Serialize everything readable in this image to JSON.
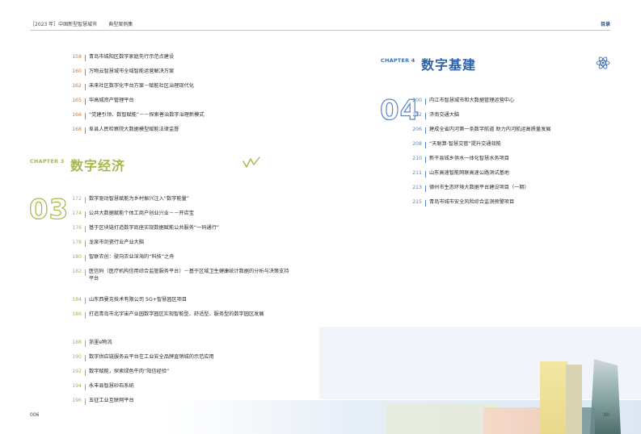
{
  "header": {
    "book_title": "［2023 年］中国新型智慧城市",
    "section": "典型案例集",
    "toc_label": "目录"
  },
  "prev_items": [
    {
      "page": "158",
      "title": "青岛市城阳区数字家庭先行示范点建设"
    },
    {
      "page": "160",
      "title": "万物云智慧城市全域智能运营解决方案"
    },
    {
      "page": "162",
      "title": "未来社区数字化平台方案－赋能社区治理现代化"
    },
    {
      "page": "165",
      "title": "华高城资产管理平台"
    },
    {
      "page": "166",
      "title": "“党建引领、数智赋能”－－探索善治数字治理新模式"
    },
    {
      "page": "168",
      "title": "阜县人民检察院大数据模型赋能法律监督"
    }
  ],
  "chapter3": {
    "label": "CHAPTER 3",
    "title": "数字经济",
    "number": "03",
    "items": [
      {
        "page": "172",
        "title": "数字驱动智慧赋能为乡村振兴注入“数字能量”"
      },
      {
        "page": "174",
        "title": "公共大数据赋能个体工商户创业兴业－－开店宝"
      },
      {
        "page": "176",
        "title": "基于区块链打造数字底座实现数据赋能公共服务“一码通行”"
      },
      {
        "page": "178",
        "title": "龙泉市剑瓷行业产业大脑"
      },
      {
        "page": "180",
        "title": "智联农创：驶向农业深海的“科技”之舟"
      },
      {
        "page": "182",
        "title": "医信码（医疗机构信用综合监管服务平台）－基于区域卫生健康统计数据的分析与决策支持平台"
      },
      {
        "page": "184",
        "title": "山东西曼克技术有限公司 5G+智慧园区项目"
      },
      {
        "page": "186",
        "title": "打造青岛市北宇宙产业园数字园区实现智能型、舒适型、服务型的数字园区发展"
      },
      {
        "page": "188",
        "title": "浙里e物流"
      },
      {
        "page": "190",
        "title": "数字供应链服务云平台在工业安全品牌直销城的示范应用"
      },
      {
        "page": "192",
        "title": "数字赋能，探索绿色牛肉“阳信经验”"
      },
      {
        "page": "194",
        "title": "永丰县智慧砂石系统"
      },
      {
        "page": "196",
        "title": "五征工业互联网平台"
      }
    ]
  },
  "chapter4": {
    "label": "CHAPTER 4",
    "title": "数字基建",
    "number": "04",
    "items": [
      {
        "page": "200",
        "title": "内江市智慧城市和大数据管理运营中心"
      },
      {
        "page": "202",
        "title": "济南交通大脑"
      },
      {
        "page": "206",
        "title": "建成全省内河第一条数字航道 助力内河航运高质量发展"
      },
      {
        "page": "208",
        "title": "“天聪算·智慧交管”提升交通效能"
      },
      {
        "page": "210",
        "title": "新干县城乡供水一体化智慧水务项目"
      },
      {
        "page": "211",
        "title": "山东高速智能网联高速公路测试基地"
      },
      {
        "page": "213",
        "title": "德州市生态环境大数据平台建设项目（一期）"
      },
      {
        "page": "215",
        "title": "青岛市城市安全风险综合监测预警项目"
      }
    ]
  },
  "footer": {
    "page_left": "006",
    "page_right": "00"
  },
  "colors": {
    "orange": "#d9792b",
    "green": "#a6b74c",
    "blue": "#3b6fb4"
  },
  "icons": {
    "chapter3": "trend-line-icon",
    "chapter4": "atom-icon"
  }
}
